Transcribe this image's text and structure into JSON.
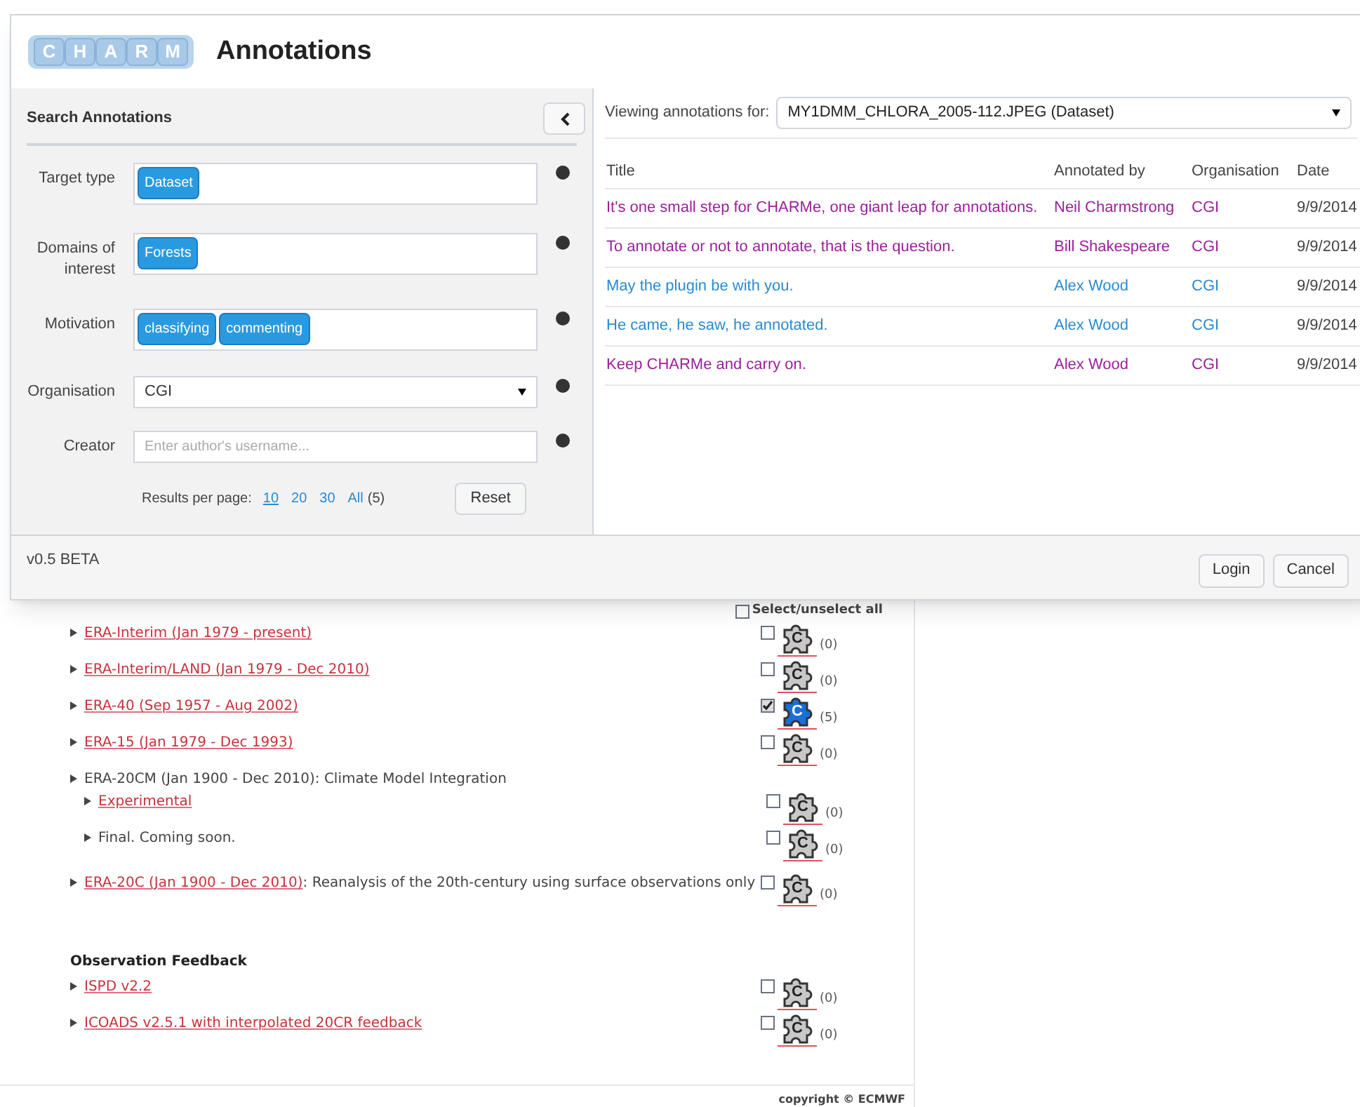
{
  "dialog": {
    "logo_letters": [
      "C",
      "H",
      "A",
      "R",
      "M"
    ],
    "title": "Annotations",
    "search_panel": {
      "heading": "Search Annotations",
      "filters": [
        {
          "kind": "tags",
          "label": "Target type",
          "tags": [
            "Dataset"
          ]
        },
        {
          "kind": "tags",
          "label": "Domains of interest",
          "tags": [
            "Forests"
          ]
        },
        {
          "kind": "tags",
          "label": "Motivation",
          "tags": [
            "classifying",
            "commenting"
          ]
        },
        {
          "kind": "select",
          "label": "Organisation",
          "value": "CGI"
        },
        {
          "kind": "text",
          "label": "Creator",
          "placeholder": "Enter author's username..."
        }
      ],
      "results_per_page": {
        "label": "Results per page:",
        "options": [
          {
            "label": "10",
            "selected": true
          },
          {
            "label": "20",
            "selected": false
          },
          {
            "label": "30",
            "selected": false
          },
          {
            "label": "All",
            "selected": false
          }
        ],
        "total": "(5)"
      },
      "reset_button": "Reset"
    },
    "viewer": {
      "label": "Viewing annotations for:",
      "target": "MY1DMM_CHLORA_2005-112.JPEG (Dataset)",
      "columns": [
        "Title",
        "Annotated by",
        "Organisation",
        "Date"
      ],
      "rows": [
        {
          "title": "It's one small step for CHARMe, one giant leap for annotations.",
          "author": "Neil Charmstrong",
          "organisation": "CGI",
          "date": "9/9/2014",
          "visited": true
        },
        {
          "title": "To annotate or not to annotate, that is the question.",
          "author": "Bill Shakespeare",
          "organisation": "CGI",
          "date": "9/9/2014",
          "visited": true
        },
        {
          "title": "May the plugin be with you.",
          "author": "Alex Wood",
          "organisation": "CGI",
          "date": "9/9/2014",
          "visited": false
        },
        {
          "title": "He came, he saw, he annotated.",
          "author": "Alex Wood",
          "organisation": "CGI",
          "date": "9/9/2014",
          "visited": false
        },
        {
          "title": "Keep CHARMe and carry on.",
          "author": "Alex Wood",
          "organisation": "CGI",
          "date": "9/9/2014",
          "visited": true
        }
      ]
    },
    "version": "v0.5 BETA",
    "buttons": [
      "Login",
      "Cancel"
    ]
  },
  "page": {
    "select_all": {
      "label": "Select/unselect all",
      "checked": false
    },
    "sections": [
      {
        "items": [
          {
            "kind": "link",
            "label": "ERA-Interim (Jan 1979 - present)",
            "checked": false,
            "icon_label": "C",
            "count": "(0)"
          },
          {
            "kind": "link",
            "label": "ERA-Interim/LAND (Jan 1979 - Dec 2010)",
            "checked": false,
            "icon_label": "C",
            "count": "(0)"
          },
          {
            "kind": "link",
            "label": "ERA-40 (Sep 1957 - Aug 2002)",
            "checked": true,
            "icon_label": "C",
            "count": "(5)"
          },
          {
            "kind": "link",
            "label": "ERA-15 (Jan 1979 - Dec 1993)",
            "checked": false,
            "icon_label": "C",
            "count": "(0)"
          },
          {
            "kind": "text",
            "label": "ERA-20CM (Jan 1900 - Dec 2010): Climate Model Integration",
            "children": [
              {
                "kind": "link",
                "label": "Experimental",
                "checked": false,
                "icon_label": "C",
                "count": "(0)"
              },
              {
                "kind": "text",
                "label": "Final. Coming soon.",
                "checked": false,
                "icon_label": "C",
                "count": "(0)"
              }
            ]
          },
          {
            "kind": "link",
            "label": "ERA-20C (Jan 1900 - Dec 2010)",
            "description": ": Reanalysis of the 20th-century using surface observations only",
            "checked": false,
            "icon_label": "C",
            "count": "(0)"
          }
        ]
      },
      {
        "heading": "Observation Feedback",
        "items": [
          {
            "kind": "link",
            "label": "ISPD v2.2",
            "checked": false,
            "icon_label": "C",
            "count": "(0)"
          },
          {
            "kind": "link",
            "label": "ICOADS v2.5.1 with interpolated 20CR feedback",
            "checked": false,
            "icon_label": "C",
            "count": "(0)"
          }
        ]
      }
    ],
    "copyright": "copyright © ECMWF"
  }
}
